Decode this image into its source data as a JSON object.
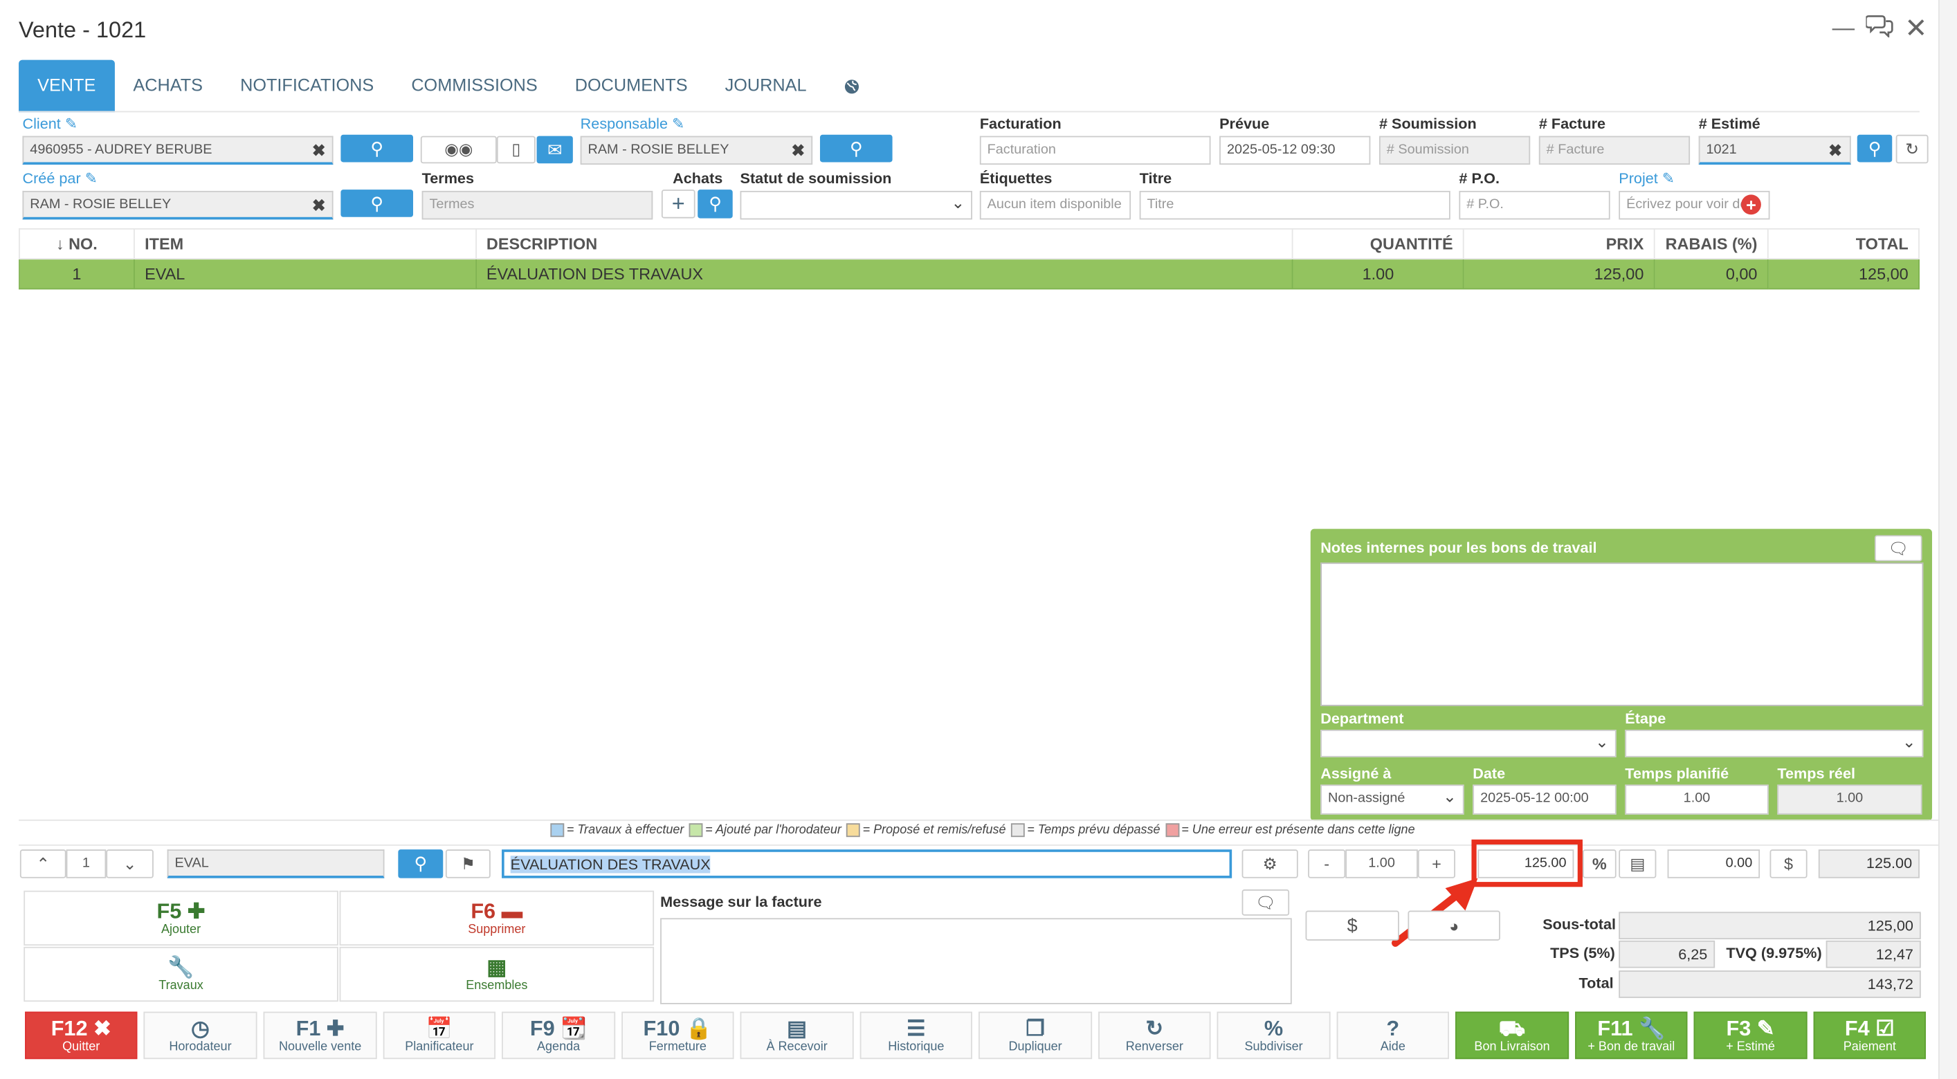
{
  "window": {
    "title": "Vente - 1021"
  },
  "tabs": [
    {
      "label": "VENTE"
    },
    {
      "label": "ACHATS"
    },
    {
      "label": "NOTIFICATIONS"
    },
    {
      "label": "COMMISSIONS"
    },
    {
      "label": "DOCUMENTS"
    },
    {
      "label": "JOURNAL"
    }
  ],
  "form": {
    "client_label": "Client",
    "client_value": "4960955 - AUDREY BERUBE",
    "responsable_label": "Responsable",
    "responsable_value": "RAM - ROSIE BELLEY",
    "cree_par_label": "Créé par",
    "cree_par_value": "RAM - ROSIE BELLEY",
    "termes_label": "Termes",
    "termes_placeholder": "Termes",
    "achats_label": "Achats",
    "statut_label": "Statut de soumission",
    "facturation_label": "Facturation",
    "facturation_placeholder": "Facturation",
    "prevue_label": "Prévue",
    "prevue_value": "2025-05-12 09:30",
    "soumission_label": "# Soumission",
    "soumission_placeholder": "# Soumission",
    "facture_label": "# Facture",
    "facture_placeholder": "# Facture",
    "estime_label": "# Estimé",
    "estime_value": "1021",
    "etiquettes_label": "Étiquettes",
    "etiquettes_value": "Aucun item disponible",
    "titre_label": "Titre",
    "titre_placeholder": "Titre",
    "po_label": "# P.O.",
    "po_placeholder": "# P.O.",
    "projet_label": "Projet",
    "projet_placeholder": "Écrivez pour voir de..."
  },
  "table": {
    "headers": [
      "↓ NO.",
      "ITEM",
      "DESCRIPTION",
      "QUANTITÉ",
      "PRIX",
      "RABAIS (%)",
      "TOTAL"
    ],
    "rows": [
      {
        "no": "1",
        "item": "EVAL",
        "description": "ÉVALUATION DES TRAVAUX",
        "quantite": "1.00",
        "prix": "125,00",
        "rabais": "0,00",
        "total": "125,00"
      }
    ]
  },
  "notes": {
    "title": "Notes internes pour les bons de travail",
    "department_label": "Department",
    "etape_label": "Étape",
    "assigne_label": "Assigné à",
    "assigne_value": "Non-assigné",
    "date_label": "Date",
    "date_value": "2025-05-12 00:00",
    "temps_planifie_label": "Temps planifié",
    "temps_planifie_value": "1.00",
    "temps_reel_label": "Temps réel",
    "temps_reel_value": "1.00"
  },
  "legend": [
    {
      "text": "= Travaux à effectuer",
      "color": "#a9d1f0"
    },
    {
      "text": "= Ajouté par l'horodateur",
      "color": "#c6e6a8"
    },
    {
      "text": "= Proposé et remis/refusé",
      "color": "#f7dc9b"
    },
    {
      "text": "= Temps prévu dépassé",
      "color": "#e9e9e9"
    },
    {
      "text": "= Une erreur est présente dans cette ligne",
      "color": "#f0a0a0"
    }
  ],
  "editor": {
    "line_number": "1",
    "item_value": "EVAL",
    "description_value": "ÉVALUATION DES TRAVAUX",
    "qty_minus": "-",
    "qty_value": "1.00",
    "qty_plus": "+",
    "price_value": "125.00",
    "discount_value": "0.00",
    "total_value": "125.00"
  },
  "actions": {
    "f5_key": "F5",
    "f5_label": "Ajouter",
    "f6_key": "F6",
    "f6_label": "Supprimer",
    "travaux_label": "Travaux",
    "ensembles_label": "Ensembles"
  },
  "message": {
    "label": "Message sur la facture"
  },
  "totals": {
    "soustotal_label": "Sous-total",
    "soustotal_value": "125,00",
    "tps_label": "TPS (5%)",
    "tps_value": "6,25",
    "tvq_label": "TVQ (9.975%)",
    "tvq_value": "12,47",
    "total_label": "Total",
    "total_value": "143,72"
  },
  "footer": [
    {
      "key": "F12",
      "label": "Quitter"
    },
    {
      "key": "",
      "label": "Horodateur"
    },
    {
      "key": "F1",
      "label": "Nouvelle vente"
    },
    {
      "key": "",
      "label": "Planificateur"
    },
    {
      "key": "F9",
      "label": "Agenda"
    },
    {
      "key": "F10",
      "label": "Fermeture"
    },
    {
      "key": "",
      "label": "À Recevoir"
    },
    {
      "key": "",
      "label": "Historique"
    },
    {
      "key": "",
      "label": "Dupliquer"
    },
    {
      "key": "",
      "label": "Renverser"
    },
    {
      "key": "",
      "label": "Subdiviser"
    },
    {
      "key": "",
      "label": "Aide"
    },
    {
      "key": "",
      "label": "Bon Livraison"
    },
    {
      "key": "F11",
      "label": "+ Bon de travail"
    },
    {
      "key": "F3",
      "label": "+ Estimé"
    },
    {
      "key": "F4",
      "label": "Paiement"
    }
  ],
  "colors": {
    "accent": "#3a9ad9",
    "row_green": "#93c35f",
    "quit_red": "#e0413c",
    "action_green": "#6db33f",
    "highlight": "#e8301e"
  }
}
